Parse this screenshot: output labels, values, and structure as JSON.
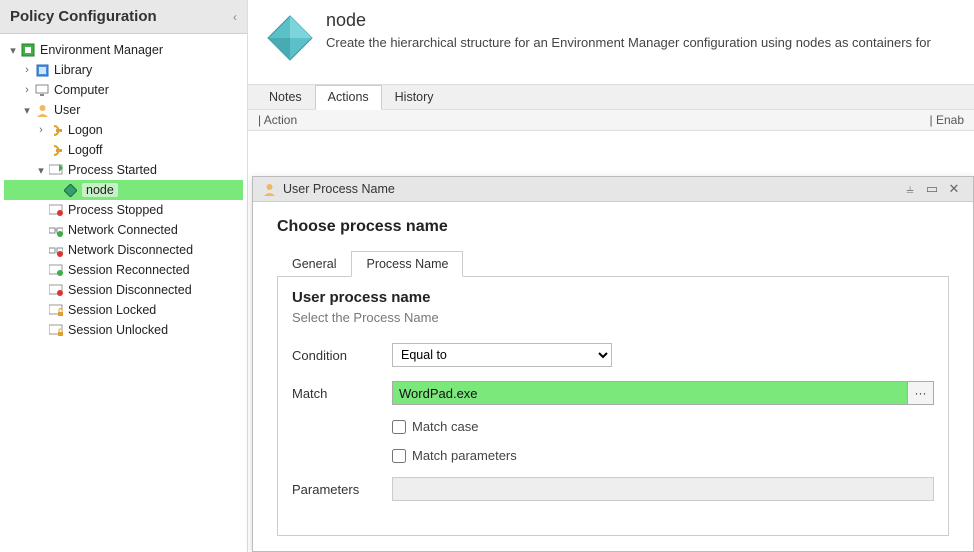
{
  "sidebar": {
    "title": "Policy Configuration",
    "tree": {
      "root": "Environment Manager",
      "library": "Library",
      "computer": "Computer",
      "user": "User",
      "logon": "Logon",
      "logoff": "Logoff",
      "process_started": "Process Started",
      "node": "node",
      "process_stopped": "Process Stopped",
      "net_connected": "Network Connected",
      "net_disconnected": "Network Disconnected",
      "sess_reconnected": "Session Reconnected",
      "sess_disconnected": "Session Disconnected",
      "sess_locked": "Session Locked",
      "sess_unlocked": "Session Unlocked"
    }
  },
  "main": {
    "title": "node",
    "description": "Create the hierarchical structure for an Environment Manager configuration using nodes as containers for",
    "tabs": {
      "notes": "Notes",
      "actions": "Actions",
      "history": "History"
    },
    "columns": {
      "action": "Action",
      "enabled": "Enab"
    }
  },
  "dialog": {
    "title": "User Process Name",
    "heading": "Choose process name",
    "tabs": {
      "general": "General",
      "process_name": "Process Name"
    },
    "panel_title": "User process name",
    "panel_sub": "Select the Process Name",
    "condition_label": "Condition",
    "condition_value": "Equal to",
    "match_label": "Match",
    "match_value": "WordPad.exe",
    "match_case": "Match case",
    "match_parameters": "Match parameters",
    "parameters_label": "Parameters"
  }
}
